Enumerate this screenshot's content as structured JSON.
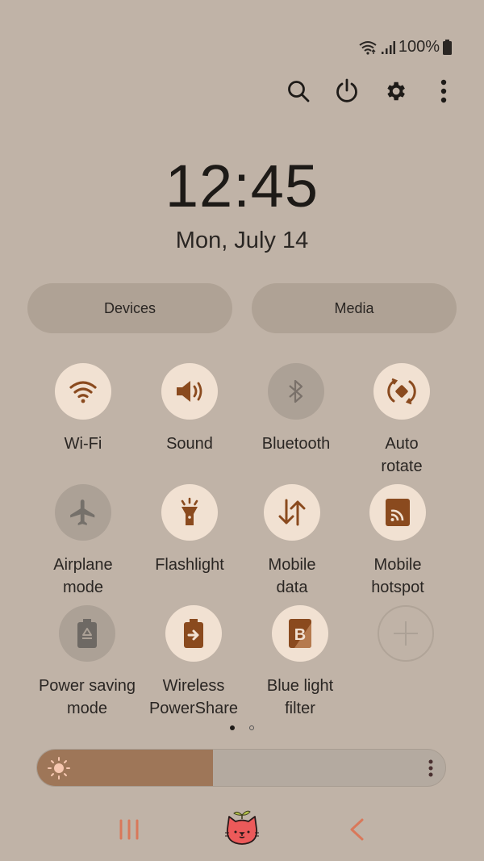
{
  "status_bar": {
    "battery_text": "100%",
    "icons": [
      "wifi-icon",
      "signal-icon",
      "battery-icon"
    ]
  },
  "toolbar": {
    "buttons": [
      {
        "name": "search",
        "icon": "search-icon"
      },
      {
        "name": "power",
        "icon": "power-icon"
      },
      {
        "name": "settings",
        "icon": "gear-icon"
      },
      {
        "name": "more",
        "icon": "more-vertical-icon"
      }
    ]
  },
  "clock": {
    "time": "12:45",
    "date": "Mon, July 14"
  },
  "pills": {
    "devices": "Devices",
    "media": "Media"
  },
  "tiles": [
    {
      "label": "Wi-Fi",
      "state": "on",
      "icon": "wifi-icon"
    },
    {
      "label": "Sound",
      "state": "on",
      "icon": "speaker-icon"
    },
    {
      "label": "Bluetooth",
      "state": "off",
      "icon": "bluetooth-icon"
    },
    {
      "label": "Auto\nrotate",
      "state": "on",
      "icon": "auto-rotate-icon"
    },
    {
      "label": "Airplane\nmode",
      "state": "off",
      "icon": "airplane-icon"
    },
    {
      "label": "Flashlight",
      "state": "on",
      "icon": "flashlight-icon"
    },
    {
      "label": "Mobile\ndata",
      "state": "on",
      "icon": "mobile-data-icon"
    },
    {
      "label": "Mobile\nhotspot",
      "state": "on",
      "icon": "hotspot-icon"
    },
    {
      "label": "Power saving\nmode",
      "state": "off",
      "icon": "power-saving-icon"
    },
    {
      "label": "Wireless\nPowerShare",
      "state": "on",
      "icon": "wireless-powershare-icon"
    },
    {
      "label": "Blue light\nfilter",
      "state": "on",
      "icon": "blue-light-filter-icon"
    },
    {
      "label": "",
      "state": "add",
      "icon": "plus-icon"
    }
  ],
  "pagination": {
    "current": 1,
    "total": 2
  },
  "brightness": {
    "level_percent": 43
  },
  "colors": {
    "background": "#c0b3a7",
    "tile_on": "#f1e1d2",
    "tile_off": "#aca196",
    "accent": "#8a4a1e",
    "brightness_fill": "#9e7658",
    "nav_accent": "#d9785a"
  },
  "nav_bar": {
    "buttons": [
      {
        "name": "recents",
        "icon": "recents-icon"
      },
      {
        "name": "home",
        "icon": "cat-home-icon"
      },
      {
        "name": "back",
        "icon": "back-chevron-icon"
      }
    ]
  }
}
